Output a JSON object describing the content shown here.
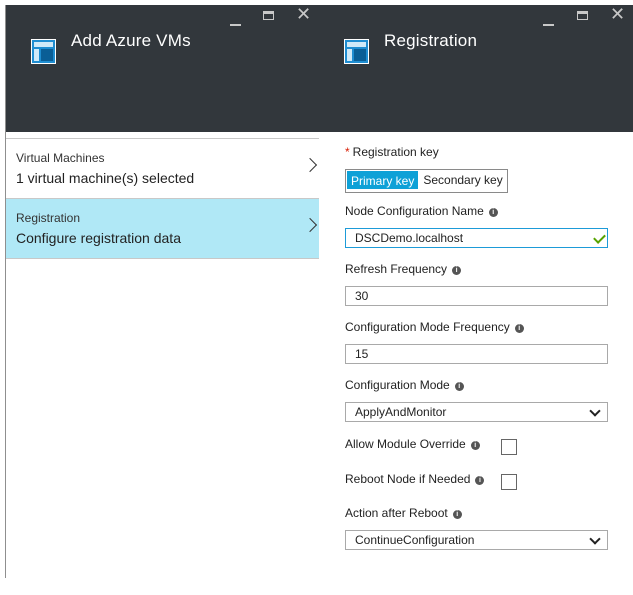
{
  "left_blade": {
    "title": "Add Azure VMs",
    "window_controls": {
      "minimize": "_",
      "maximize": "□",
      "close": "✕"
    },
    "items": [
      {
        "label": "Virtual Machines",
        "value": "1 virtual machine(s) selected"
      },
      {
        "label": "Registration",
        "value": "Configure registration data"
      }
    ]
  },
  "right_blade": {
    "title": "Registration",
    "window_controls": {
      "minimize": "_",
      "maximize": "□",
      "close": "✕"
    },
    "registration_key": {
      "required_mark": "*",
      "label": "Registration key",
      "options": [
        "Primary key",
        "Secondary key"
      ],
      "selected": "Primary key"
    },
    "node_config_name": {
      "label": "Node Configuration Name",
      "value": "DSCDemo.localhost",
      "valid": true
    },
    "refresh_frequency": {
      "label": "Refresh Frequency",
      "value": "30"
    },
    "config_mode_frequency": {
      "label": "Configuration Mode Frequency",
      "value": "15"
    },
    "config_mode": {
      "label": "Configuration Mode",
      "value": "ApplyAndMonitor"
    },
    "allow_module_override": {
      "label": "Allow Module Override",
      "checked": false
    },
    "reboot_node": {
      "label": "Reboot Node if Needed",
      "checked": false
    },
    "action_after_reboot": {
      "label": "Action after Reboot",
      "value": "ContinueConfiguration"
    },
    "info_glyph": "i"
  },
  "colors": {
    "header_bg": "#32373c",
    "selected_item_bg": "#b0e8f6",
    "toggle_active_bg": "#0ea1d7",
    "focus_border": "#1d9bd8",
    "valid_check": "#57a300",
    "required_star": "#d81e05"
  }
}
